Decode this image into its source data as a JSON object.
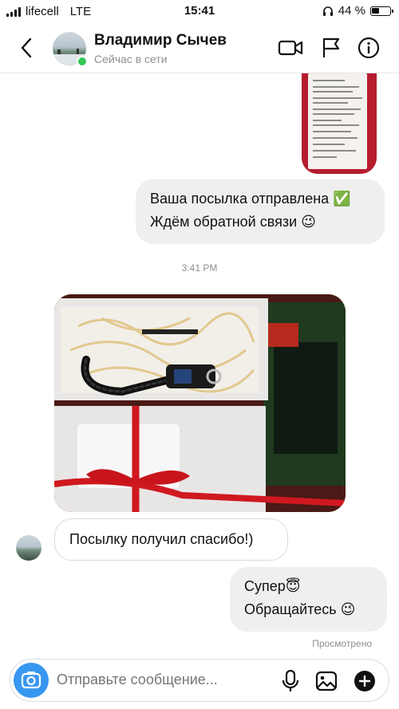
{
  "status_bar": {
    "carrier": "lifecell",
    "network": "LTE",
    "time": "15:41",
    "battery": "44 %"
  },
  "header": {
    "name": "Владимир Сычев",
    "status": "Сейчас в сети",
    "icons": [
      "back-icon",
      "video-call-icon",
      "flag-icon",
      "info-icon"
    ]
  },
  "messages": {
    "outgoing_1_line1": "Ваша посылка отправлена ✅",
    "outgoing_1_line2": "Ждём обратной связи 😉",
    "timestamp": "3:41 PM",
    "incoming_1": "Посылку получил спасибо!)",
    "outgoing_2_line1": "Супер😇",
    "outgoing_2_line2": "Обращайтесь 😉",
    "seen_label": "Просмотрено"
  },
  "composer": {
    "placeholder": "Отправьте сообщение...",
    "icons": [
      "camera-icon",
      "microphone-icon",
      "gallery-icon",
      "add-icon"
    ]
  },
  "colors": {
    "accent": "#3897f0",
    "online": "#34c759",
    "outgoing_bubble": "#efefef"
  }
}
